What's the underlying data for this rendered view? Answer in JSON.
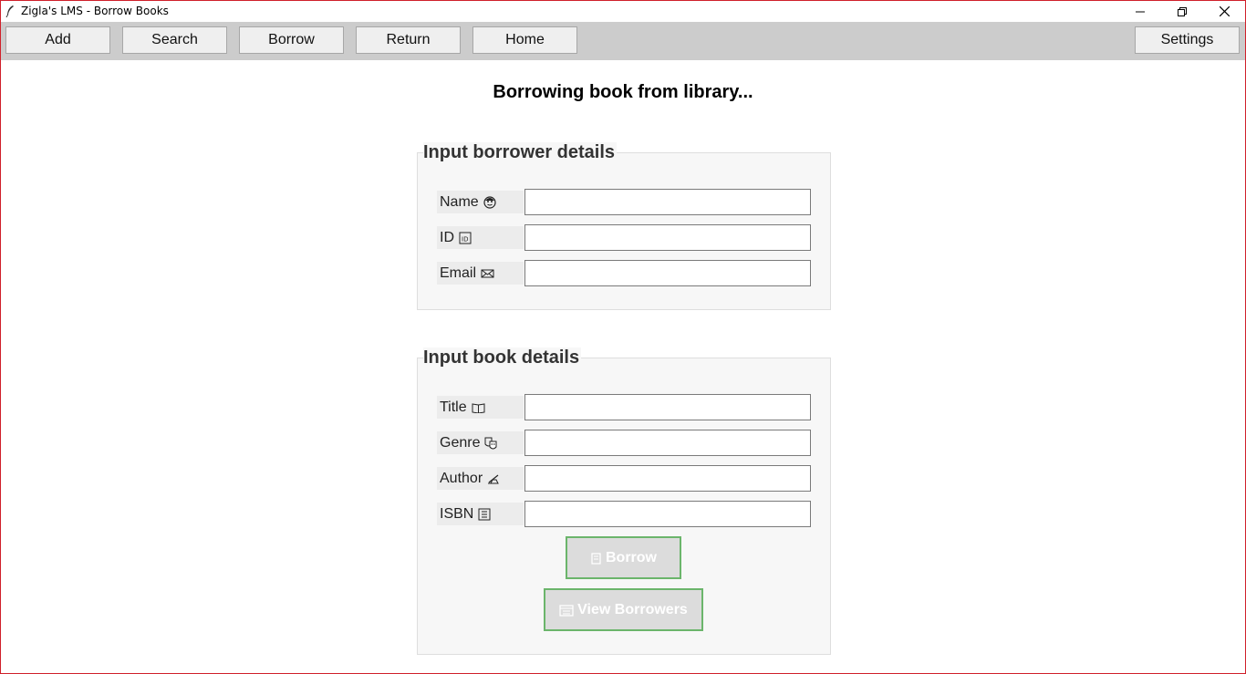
{
  "window": {
    "title": "Zigla's LMS - Borrow Books"
  },
  "toolbar": {
    "add_label": "Add",
    "search_label": "Search",
    "borrow_label": "Borrow",
    "return_label": "Return",
    "home_label": "Home",
    "settings_label": "Settings"
  },
  "page": {
    "heading": "Borrowing book from library..."
  },
  "borrower_group": {
    "title": "Input borrower details",
    "fields": [
      {
        "label": "Name",
        "icon": "face-icon",
        "value": ""
      },
      {
        "label": "ID",
        "icon": "id-icon",
        "value": ""
      },
      {
        "label": "Email",
        "icon": "envelope-icon",
        "value": ""
      }
    ]
  },
  "book_group": {
    "title": "Input book details",
    "fields": [
      {
        "label": "Title",
        "icon": "open-book-icon",
        "value": ""
      },
      {
        "label": "Genre",
        "icon": "theater-masks-icon",
        "value": ""
      },
      {
        "label": "Author",
        "icon": "writing-hand-icon",
        "value": ""
      },
      {
        "label": "ISBN",
        "icon": "barcode-icon",
        "value": ""
      }
    ],
    "borrow_button": "Borrow",
    "view_borrowers_button": "View Borrowers"
  },
  "colors": {
    "toolbar_bg": "#cccccc",
    "window_border": "#d0202a",
    "button_border_green": "#6bb56b"
  }
}
